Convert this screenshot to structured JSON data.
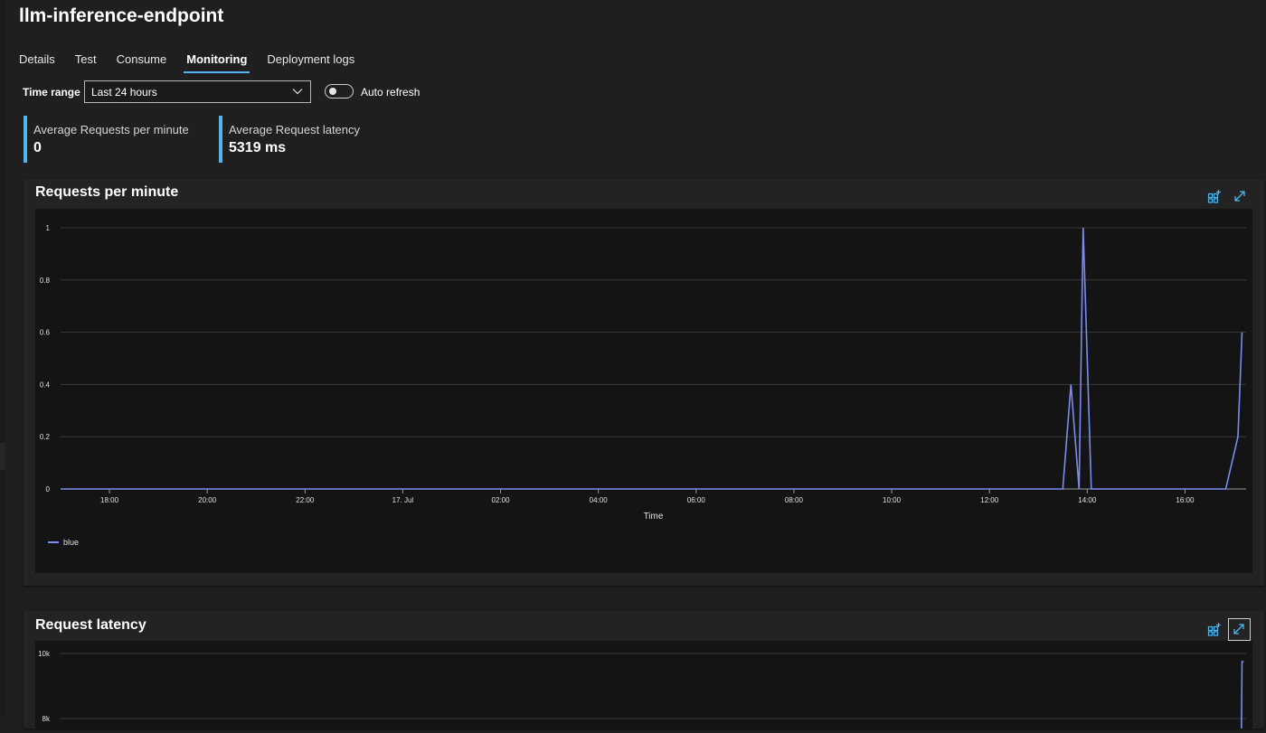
{
  "page": {
    "title": "llm-inference-endpoint"
  },
  "tabs": [
    {
      "label": "Details",
      "active": false
    },
    {
      "label": "Test",
      "active": false
    },
    {
      "label": "Consume",
      "active": false
    },
    {
      "label": "Monitoring",
      "active": true
    },
    {
      "label": "Deployment logs",
      "active": false
    }
  ],
  "filters": {
    "time_range_label": "Time range",
    "time_range_value": "Last 24 hours",
    "auto_refresh_label": "Auto refresh",
    "auto_refresh_on": false
  },
  "metrics": [
    {
      "label": "Average Requests per minute",
      "value": "0"
    },
    {
      "label": "Average Request latency",
      "value": "5319 ms"
    }
  ],
  "colors": {
    "accent": "#4fb6f0",
    "series": "#7b8cf0",
    "grid": "#3a3a3a"
  },
  "charts": {
    "requests": {
      "title": "Requests per minute"
    },
    "latency": {
      "title": "Request latency"
    }
  },
  "chart_data": [
    {
      "type": "line",
      "title": "Requests per minute",
      "xlabel": "Time",
      "ylabel": "",
      "ylim": [
        0,
        1
      ],
      "yticks": [
        {
          "v": 0,
          "label": "0"
        },
        {
          "v": 0.2,
          "label": "0.2"
        },
        {
          "v": 0.4,
          "label": "0.4"
        },
        {
          "v": 0.6,
          "label": "0.6"
        },
        {
          "v": 0.8,
          "label": "0.8"
        },
        {
          "v": 1,
          "label": "1"
        }
      ],
      "xlim": [
        "2024-07-16 17:00",
        "2024-07-17 17:15"
      ],
      "xticks": [
        {
          "t": "2024-07-16 18:00",
          "label": "18:00"
        },
        {
          "t": "2024-07-16 20:00",
          "label": "20:00"
        },
        {
          "t": "2024-07-16 22:00",
          "label": "22:00"
        },
        {
          "t": "2024-07-17 00:00",
          "label": "17. Jul"
        },
        {
          "t": "2024-07-17 02:00",
          "label": "02:00"
        },
        {
          "t": "2024-07-17 04:00",
          "label": "04:00"
        },
        {
          "t": "2024-07-17 06:00",
          "label": "06:00"
        },
        {
          "t": "2024-07-17 08:00",
          "label": "08:00"
        },
        {
          "t": "2024-07-17 10:00",
          "label": "10:00"
        },
        {
          "t": "2024-07-17 12:00",
          "label": "12:00"
        },
        {
          "t": "2024-07-17 14:00",
          "label": "14:00"
        },
        {
          "t": "2024-07-17 16:00",
          "label": "16:00"
        }
      ],
      "grid": true,
      "legend_position": "bottom-left",
      "series": [
        {
          "name": "blue",
          "points": [
            [
              "2024-07-16 17:00",
              0
            ],
            [
              "2024-07-17 13:30",
              0
            ],
            [
              "2024-07-17 13:40",
              0.4
            ],
            [
              "2024-07-17 13:50",
              0
            ],
            [
              "2024-07-17 13:55",
              1
            ],
            [
              "2024-07-17 14:05",
              0
            ],
            [
              "2024-07-17 16:50",
              0
            ],
            [
              "2024-07-17 17:05",
              0.2
            ],
            [
              "2024-07-17 17:10",
              0.6
            ]
          ]
        }
      ]
    },
    {
      "type": "line",
      "title": "Request latency",
      "ylim": [
        0,
        10000
      ],
      "yticks": [
        {
          "v": 8000,
          "label": "8k"
        },
        {
          "v": 10000,
          "label": "10k"
        }
      ],
      "xlim": [
        "2024-07-16 17:00",
        "2024-07-17 17:15"
      ],
      "grid": true,
      "series": [
        {
          "name": "blue",
          "points": [
            [
              "2024-07-17 17:09",
              7000
            ],
            [
              "2024-07-17 17:10",
              9750
            ],
            [
              "2024-07-17 17:12",
              9750
            ]
          ]
        }
      ]
    }
  ]
}
